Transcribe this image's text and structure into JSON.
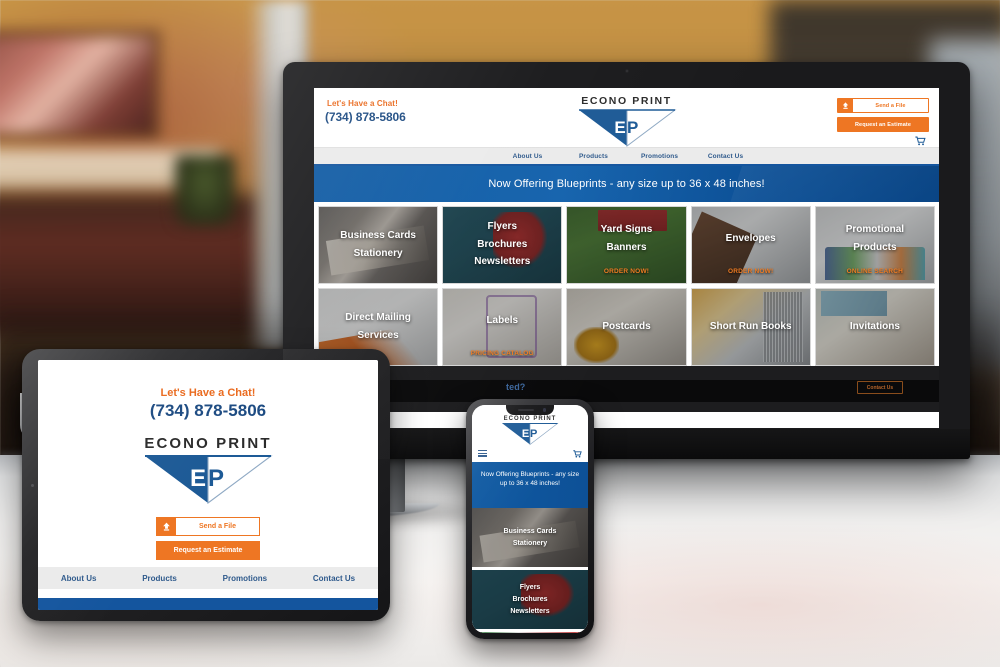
{
  "brand": {
    "name": "ECONO PRINT",
    "mark_letters": "EP",
    "accent_orange": "#ee7623",
    "accent_blue": "#14559e",
    "logo_blue": "#1d5a96"
  },
  "desktop": {
    "header": {
      "chat_label": "Let's Have a Chat!",
      "phone": "(734) 878-5806",
      "send_file_label": "Send a File",
      "estimate_label": "Request an Estimate",
      "upload_icon": "upload-arrow-icon",
      "cart_icon": "shopping-cart-icon"
    },
    "nav": [
      {
        "label": "About Us"
      },
      {
        "label": "Products"
      },
      {
        "label": "Promotions"
      },
      {
        "label": "Contact Us"
      }
    ],
    "banner": {
      "text": "Now Offering Blueprints - any size up to 36 x 48 inches!"
    },
    "tiles": [
      {
        "lines": [
          "Business Cards",
          "Stationery"
        ],
        "cta": "",
        "photo": "ph-cards"
      },
      {
        "lines": [
          "Flyers",
          "Brochures",
          "Newsletters"
        ],
        "cta": "",
        "photo": "ph-flyers"
      },
      {
        "lines": [
          "Yard Signs",
          "Banners"
        ],
        "cta": "ORDER NOW!",
        "photo": "ph-yard"
      },
      {
        "lines": [
          "Envelopes"
        ],
        "cta": "ORDER NOW!",
        "photo": "ph-env"
      },
      {
        "lines": [
          "Promotional",
          "Products"
        ],
        "cta": "ONLINE SEARCH",
        "photo": "ph-promo"
      },
      {
        "lines": [
          "Direct Mailing",
          "Services"
        ],
        "cta": "",
        "photo": "ph-mail"
      },
      {
        "lines": [
          "Labels"
        ],
        "cta": "PRICING CATALOG",
        "photo": "ph-labels"
      },
      {
        "lines": [
          "Postcards"
        ],
        "cta": "",
        "photo": "ph-post"
      },
      {
        "lines": [
          "Short Run Books"
        ],
        "cta": "",
        "photo": "ph-books"
      },
      {
        "lines": [
          "Invitations"
        ],
        "cta": "",
        "photo": "ph-invite"
      }
    ],
    "footer": {
      "headline": "ted?",
      "button_label": "Contact Us"
    }
  },
  "tablet": {
    "chat_label": "Let's Have a Chat!",
    "phone": "(734) 878-5806",
    "send_file_label": "Send a File",
    "estimate_label": "Request an Estimate",
    "nav": [
      {
        "label": "About Us"
      },
      {
        "label": "Products"
      },
      {
        "label": "Promotions"
      },
      {
        "label": "Contact Us"
      }
    ]
  },
  "phone": {
    "banner": "Now Offering Blueprints - any size up to 36 x 48 inches!",
    "menu_icon": "hamburger-menu-icon",
    "cart_icon": "shopping-cart-icon",
    "tiles": [
      {
        "lines": [
          "Business Cards",
          "Stationery"
        ],
        "photo": "ph-cards"
      },
      {
        "lines": [
          "Flyers",
          "Brochures",
          "Newsletters"
        ],
        "photo": "ph-flyers"
      }
    ]
  }
}
